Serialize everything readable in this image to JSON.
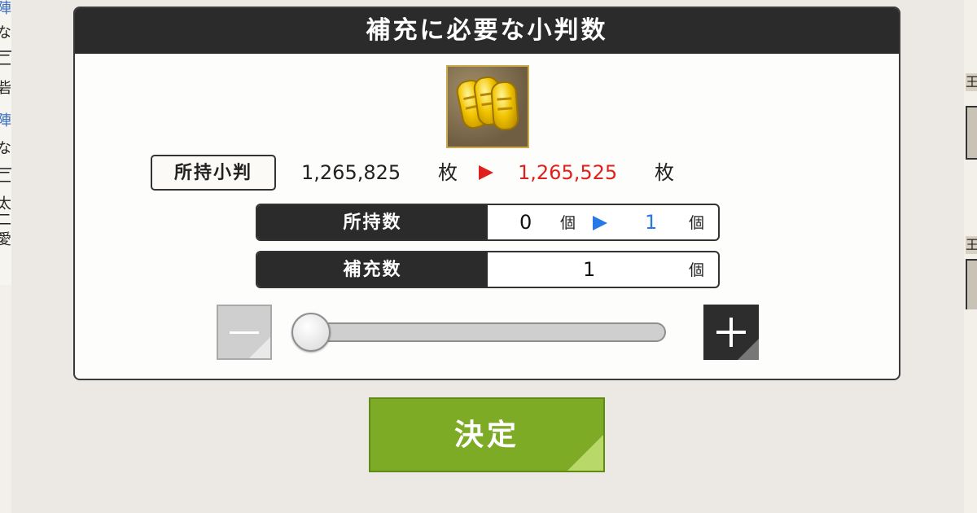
{
  "background": {
    "left_glyphs": [
      "陣",
      "な",
      "二",
      "砦",
      "陣",
      "な",
      "二",
      "太",
      "二",
      "愛"
    ],
    "right_chips": [
      "王",
      "王"
    ]
  },
  "dialog": {
    "title": "補充に必要な小判数",
    "item_icon": "koban-gold-coins-icon",
    "owned_coins": {
      "label": "所持小判",
      "from": "1,265,825",
      "to": "1,265,525",
      "unit": "枚"
    },
    "rows": {
      "owned_count": {
        "label": "所持数",
        "from": "0",
        "to": "1",
        "unit": "個"
      },
      "refill_count": {
        "label": "補充数",
        "value": "1",
        "unit": "個"
      }
    },
    "slider": {
      "value": 1,
      "min": 1,
      "max": 1,
      "position_fraction": 0
    },
    "minus_button_icon": "minus-icon",
    "plus_button_icon": "plus-icon",
    "confirm_label": "決定"
  },
  "colors": {
    "title_bar": "#2b2b2b",
    "decrease_red": "#e0201c",
    "increase_blue": "#2778e8",
    "confirm_green": "#7eab26"
  }
}
